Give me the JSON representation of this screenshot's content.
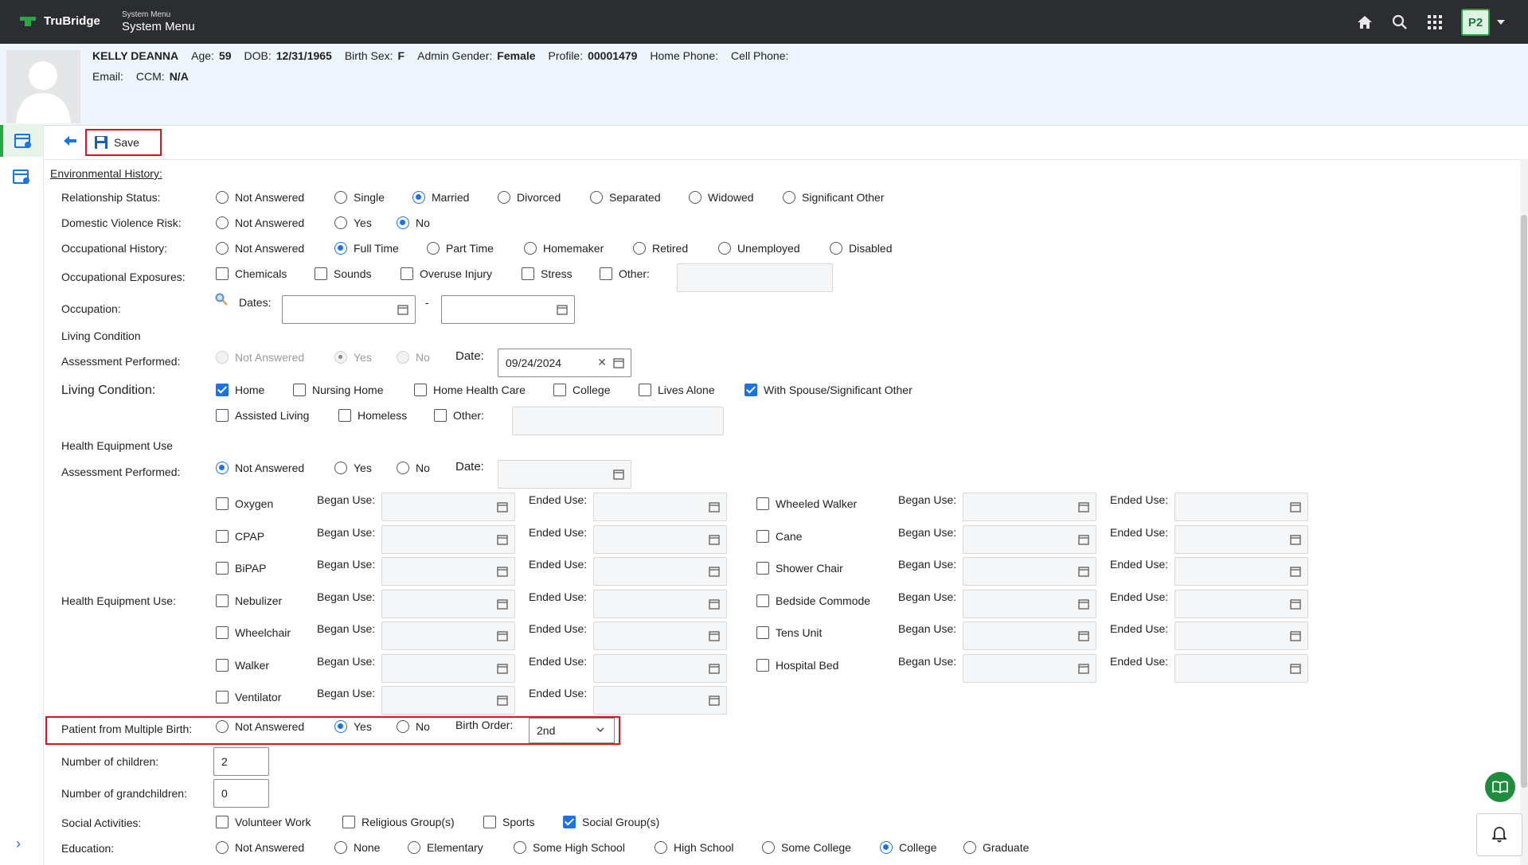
{
  "topbar": {
    "brand": "TruBridge",
    "menu_small": "System Menu",
    "menu_big": "System Menu",
    "user_badge": "P2"
  },
  "patient": {
    "name": "KELLY DEANNA",
    "age_label": "Age:",
    "age": "59",
    "dob_label": "DOB:",
    "dob": "12/31/1965",
    "birth_sex_label": "Birth Sex:",
    "birth_sex": "F",
    "admin_gender_label": "Admin Gender:",
    "admin_gender": "Female",
    "profile_label": "Profile:",
    "profile": "00001479",
    "home_phone_label": "Home Phone:",
    "cell_phone_label": "Cell Phone:",
    "email_label": "Email:",
    "ccm_label": "CCM:",
    "ccm": "N/A"
  },
  "toolbar": {
    "save_label": "Save"
  },
  "form": {
    "section_title": "Environmental History:",
    "relationship": {
      "label": "Relationship Status:",
      "options": [
        "Not Answered",
        "Single",
        "Married",
        "Divorced",
        "Separated",
        "Widowed",
        "Significant Other"
      ],
      "selected": "Married"
    },
    "domestic": {
      "label": "Domestic Violence Risk:",
      "options": [
        "Not Answered",
        "Yes",
        "No"
      ],
      "selected": "No"
    },
    "occupational_history": {
      "label": "Occupational History:",
      "options": [
        "Not Answered",
        "Full Time",
        "Part Time",
        "Homemaker",
        "Retired",
        "Unemployed",
        "Disabled"
      ],
      "selected": "Full Time"
    },
    "exposures": {
      "label": "Occupational Exposures:",
      "options": [
        "Chemicals",
        "Sounds",
        "Overuse Injury",
        "Stress",
        "Other:"
      ]
    },
    "occupation": {
      "label": "Occupation:",
      "dates_label": "Dates:",
      "dash": "-"
    },
    "living_header": "Living Condition",
    "living_assessment": {
      "label": "Assessment Performed:",
      "options": [
        "Not Answered",
        "Yes",
        "No"
      ],
      "selected": "Yes",
      "date_label": "Date:",
      "date": "09/24/2024"
    },
    "living_condition": {
      "label": "Living Condition:",
      "row1": [
        "Home",
        "Nursing Home",
        "Home Health Care",
        "College",
        "Lives Alone",
        "With Spouse/Significant Other"
      ],
      "row2": [
        "Assisted Living",
        "Homeless",
        "Other:"
      ],
      "checked": [
        "Home",
        "With Spouse/Significant Other"
      ]
    },
    "health_header": "Health Equipment Use",
    "health_assessment": {
      "label": "Assessment Performed:",
      "options": [
        "Not Answered",
        "Yes",
        "No"
      ],
      "selected": "Not Answered",
      "date_label": "Date:"
    },
    "equipment": {
      "label": "Health Equipment Use:",
      "began_label": "Began Use:",
      "ended_label": "Ended Use:",
      "left": [
        "Oxygen",
        "CPAP",
        "BiPAP",
        "Nebulizer",
        "Wheelchair",
        "Walker",
        "Ventilator"
      ],
      "right": [
        "Wheeled Walker",
        "Cane",
        "Shower Chair",
        "Bedside Commode",
        "Tens Unit",
        "Hospital Bed"
      ]
    },
    "multiple_birth": {
      "label": "Patient from Multiple Birth:",
      "options": [
        "Not Answered",
        "Yes",
        "No"
      ],
      "selected": "Yes",
      "order_label": "Birth Order:",
      "order": "2nd"
    },
    "children": {
      "label": "Number of children:",
      "value": "2"
    },
    "grandchildren": {
      "label": "Number of grandchildren:",
      "value": "0"
    },
    "social": {
      "label": "Social Activities:",
      "options": [
        "Volunteer Work",
        "Religious Group(s)",
        "Sports",
        "Social Group(s)"
      ],
      "checked": [
        "Social Group(s)"
      ]
    },
    "education": {
      "label": "Education:",
      "options": [
        "Not Answered",
        "None",
        "Elementary",
        "Some High School",
        "High School",
        "Some College",
        "College",
        "Graduate"
      ],
      "selected": "College"
    }
  }
}
